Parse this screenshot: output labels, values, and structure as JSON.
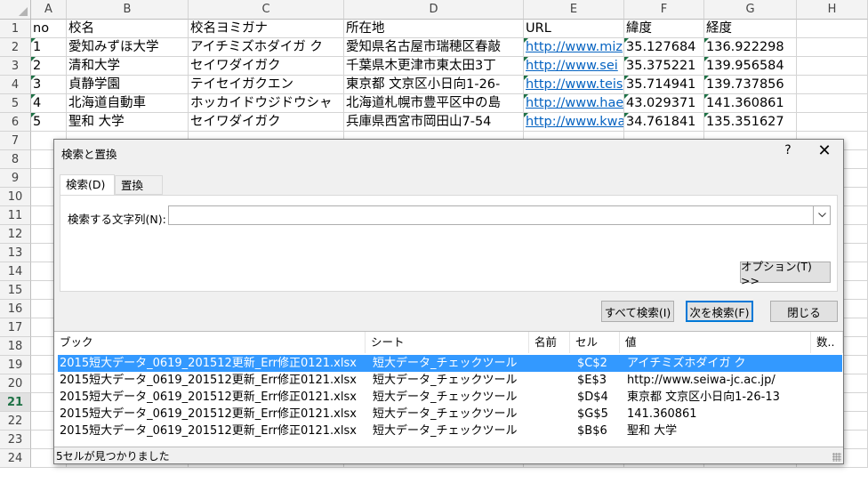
{
  "sheet": {
    "columns": [
      "A",
      "B",
      "C",
      "D",
      "E",
      "F",
      "G",
      "H"
    ],
    "rows": [
      "1",
      "2",
      "3",
      "4",
      "5",
      "6",
      "7",
      "8",
      "9",
      "10",
      "11",
      "12",
      "13",
      "14",
      "15",
      "16",
      "17",
      "18",
      "19",
      "20",
      "21",
      "22",
      "23",
      "24"
    ],
    "selected_row": "21",
    "cells": [
      [
        "no",
        "校名",
        "校名ヨミガナ",
        "所在地",
        "URL",
        "緯度",
        "経度"
      ],
      [
        "1",
        "愛知みずほ大学",
        "アイチミズホダイガ ク",
        "愛知県名古屋市瑞穂区春敲",
        "http://www.miz",
        "35.127684",
        "136.922298"
      ],
      [
        "2",
        "清和大学",
        "セイワダイガク",
        "千葉県木更津市東太田3丁",
        " http://www.sei",
        "35.375221",
        "139.956584"
      ],
      [
        "3",
        "貞静学園",
        "テイセイガクエン",
        "東京都 文京区小日向1-26-",
        "http://www.teis",
        "35.714941",
        "139.737856"
      ],
      [
        "4",
        "北海道自動車",
        "ホッカイドウジドウシャ",
        "北海道札幌市豊平区中の島",
        "http://www.hae",
        "43.029371",
        "141.360861"
      ],
      [
        "5",
        "聖和 大学",
        "セイワダイガク",
        "兵庫県西宮市岡田山7-54",
        "http://www.kwa",
        "34.761841",
        "135.351627"
      ]
    ]
  },
  "dialog": {
    "title": "検索と置換",
    "help": "?",
    "close": "✕",
    "tab_find": "検索(D)",
    "tab_replace": "置換(P)",
    "find_label": "検索する文字列(N):",
    "find_value": "",
    "options_button": "オプション(T) >>",
    "find_all_button": "すべて検索(I)",
    "find_next_button": "次を検索(F)",
    "close_button": "閉じる",
    "results_headers": [
      "ブック",
      "シート",
      "名前",
      "セル",
      "値",
      "数.."
    ],
    "results": [
      [
        "2015短大データ_0619_201512更新_Err修正0121.xlsx",
        "短大データ_チェックツール",
        "",
        "$C$2",
        "アイチミズホダイガ ク"
      ],
      [
        "2015短大データ_0619_201512更新_Err修正0121.xlsx",
        "短大データ_チェックツール",
        "",
        "$E$3",
        " http://www.seiwa-jc.ac.jp/"
      ],
      [
        "2015短大データ_0619_201512更新_Err修正0121.xlsx",
        "短大データ_チェックツール",
        "",
        "$D$4",
        "東京都 文京区小日向1-26-13"
      ],
      [
        "2015短大データ_0619_201512更新_Err修正0121.xlsx",
        "短大データ_チェックツール",
        "",
        "$G$5",
        "141.360861"
      ],
      [
        "2015短大データ_0619_201512更新_Err修正0121.xlsx",
        "短大データ_チェックツール",
        "",
        "$B$6",
        "聖和 大学"
      ]
    ],
    "status": "5セルが見つかりました"
  }
}
